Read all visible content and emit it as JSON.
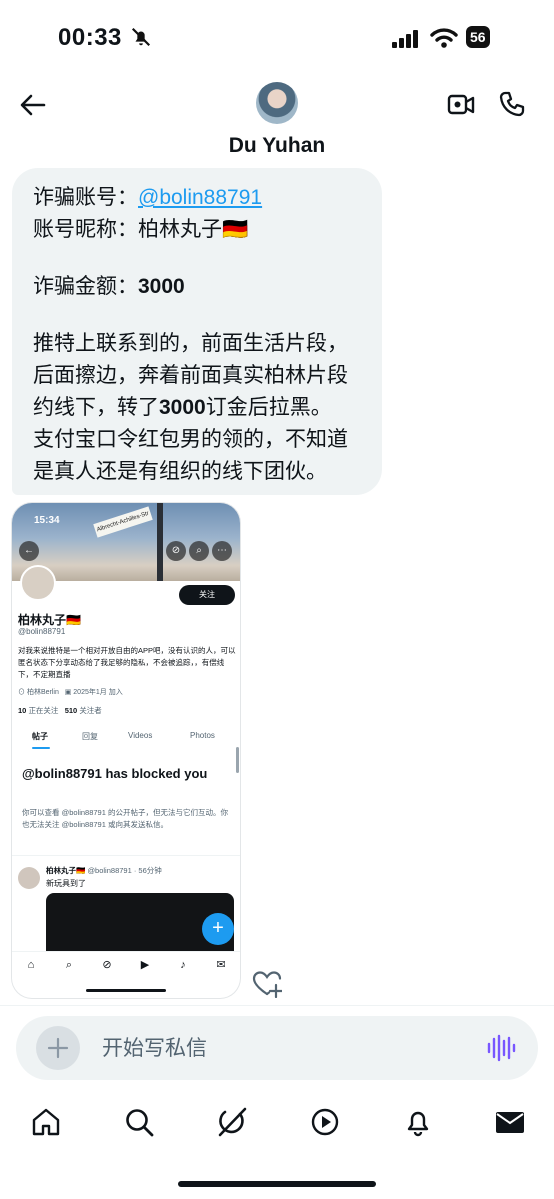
{
  "status_bar": {
    "time": "00:33",
    "battery": "56"
  },
  "header": {
    "contact_name": "Du Yuhan"
  },
  "message": {
    "lines": {
      "l1_prefix": "诈骗账号：",
      "l1_mention": "@bolin88791",
      "l2": "账号昵称：柏林丸子🇩🇪",
      "l3_prefix": "诈骗金额：",
      "l3_amount": "3000",
      "l4": "推特上联系到的，前面生活片段，",
      "l5": "后面擦边，奔着前面真实柏林片段",
      "l6_a": "约线下，转了",
      "l6_b": "3000",
      "l6_c": "订金后拉黑。",
      "l7": "支付宝口令红包男的领的，不知道",
      "l8": "是真人还是有组织的线下团伙。"
    }
  },
  "attachment": {
    "time": "15:34",
    "street_sign": "Albrecht-Achilles-Str",
    "follow_label": "关注",
    "name": "柏林丸子🇩🇪",
    "handle": "@bolin88791",
    "bio": "对我来说推特是一个相对开放自由的APP吧，没有认识的人，可以匿名状态下分享动态给了我足够的隐私，不会被追踪，，有偿线下，不定期直播",
    "location": "柏林Berlin",
    "joined": "2025年1月 加入",
    "following_count": "10",
    "following_label": "正在关注",
    "followers_count": "510",
    "followers_label": "关注者",
    "tabs": [
      "帖子",
      "回复",
      "Videos",
      "Photos"
    ],
    "blocked_title": "@bolin88791 has blocked you",
    "blocked_desc": "你可以查看 @bolin88791 的公开帖子，但无法与它们互动。你也无法关注 @bolin88791 或向其发送私信。",
    "post_name": "柏林丸子🇩🇪",
    "post_meta": "@bolin88791 · 56分钟",
    "post_text": "新玩具到了"
  },
  "composer": {
    "placeholder": "开始写私信"
  },
  "colors": {
    "accent": "#1d9bf0",
    "bubble_bg": "#eff3f4",
    "text": "#0f1419",
    "voice": "#7856ff"
  },
  "icons": {
    "back": "back-arrow-icon",
    "video": "video-call-icon",
    "phone": "phone-call-icon",
    "react": "heart-plus-icon",
    "add": "plus-icon",
    "voice": "voice-wave-icon",
    "nav": [
      "home-icon",
      "search-icon",
      "grok-icon",
      "play-icon",
      "bell-icon",
      "mail-icon"
    ]
  }
}
